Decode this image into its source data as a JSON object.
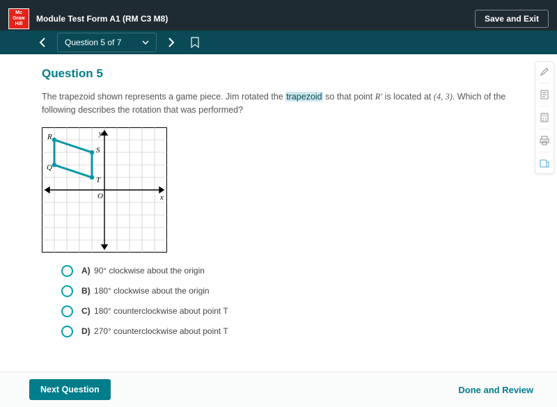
{
  "header": {
    "logo_lines": [
      "Mc",
      "Graw",
      "Hill"
    ],
    "module_title": "Module Test Form A1 (RM C3 M8)",
    "save_exit": "Save and Exit"
  },
  "nav": {
    "question_selector": "Question 5 of 7"
  },
  "question": {
    "number_label": "Question 5",
    "prompt_pre": "The trapezoid shown represents a game piece. Jim rotated the ",
    "prompt_hl": "trapezoid",
    "prompt_mid": " so that point ",
    "prompt_rprime": "R′",
    "prompt_post1": " is located at ",
    "prompt_coords": "(4, 3)",
    "prompt_post2": ". Which of the following describes the rotation that was performed?"
  },
  "chart_data": {
    "type": "scatter",
    "title": "",
    "xlabel": "x",
    "ylabel": "y",
    "xlim": [
      -5,
      5
    ],
    "ylim": [
      -5,
      5
    ],
    "grid": true,
    "series": [
      {
        "name": "trapezoid",
        "polygon": true,
        "points": [
          {
            "label": "R",
            "x": -4,
            "y": 4
          },
          {
            "label": "S",
            "x": -1,
            "y": 3
          },
          {
            "label": "T",
            "x": -1,
            "y": 1
          },
          {
            "label": "Q",
            "x": -4,
            "y": 2
          }
        ]
      }
    ],
    "origin_label": "O",
    "axis_labels": {
      "x": "x",
      "y": "y"
    }
  },
  "choices": [
    {
      "key": "A)",
      "text": "90° clockwise about the origin"
    },
    {
      "key": "B)",
      "text": "180° clockwise about the origin"
    },
    {
      "key": "C)",
      "text": "180° counterclockwise about point T"
    },
    {
      "key": "D)",
      "text": "270° counterclockwise about point T"
    }
  ],
  "tools": {
    "items": [
      "highlighter",
      "notes",
      "calculator",
      "print",
      "reference"
    ]
  },
  "footer": {
    "next": "Next Question",
    "done": "Done and Review"
  }
}
